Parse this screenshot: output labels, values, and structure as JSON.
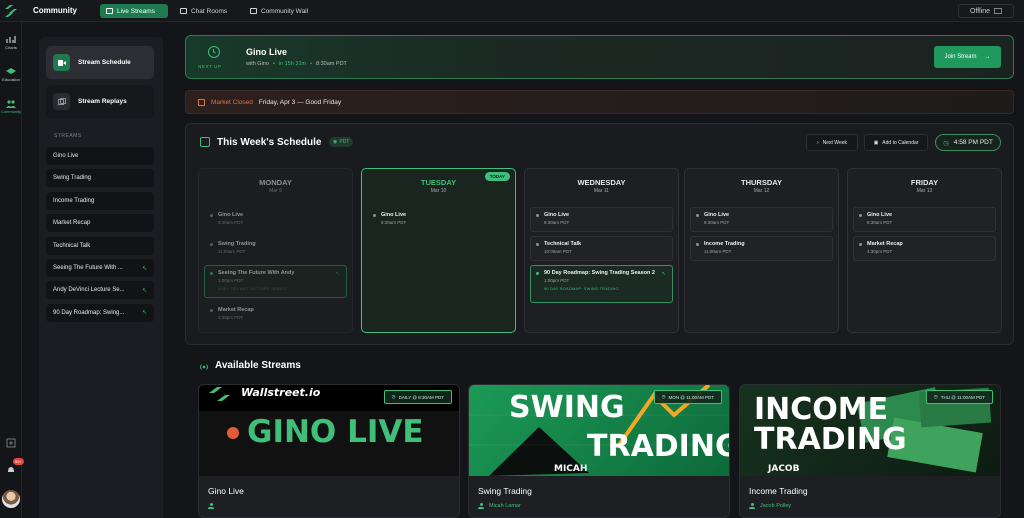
{
  "app": {
    "title": "Community"
  },
  "nav": {
    "tabs": [
      {
        "label": "Live Streams",
        "active": true
      },
      {
        "label": "Chat Rooms"
      },
      {
        "label": "Community Wall"
      }
    ],
    "status": "Offline"
  },
  "rail": {
    "items": [
      "Charts",
      "Education",
      "Community"
    ],
    "notification_count": "99+"
  },
  "sidebar": {
    "schedule_label": "Stream Schedule",
    "replays_label": "Stream Replays",
    "section_label": "STREAMS",
    "streams": [
      {
        "label": "Gino Live",
        "arrow": ""
      },
      {
        "label": "Swing Trading",
        "arrow": ""
      },
      {
        "label": "Income Trading",
        "arrow": ""
      },
      {
        "label": "Market Recap",
        "arrow": ""
      },
      {
        "label": "Technical Talk",
        "arrow": ""
      },
      {
        "label": "Seeing The Future With ...",
        "arrow": "↖"
      },
      {
        "label": "Andy DeVinci Lecture Se...",
        "arrow": "↖"
      },
      {
        "label": "90 Day Roadmap: Swing...",
        "arrow": "↖"
      }
    ]
  },
  "next_up": {
    "label": "NEXT UP",
    "title": "Gino Live",
    "host": "with Gino",
    "sep": "•",
    "countdown": "in 15h 31m",
    "time": "8:30am PDT",
    "join_label": "Join Stream",
    "join_arrow": "→"
  },
  "market": {
    "status": "Market Closed",
    "detail": "Friday, Apr 3 — Good Friday"
  },
  "schedule": {
    "title": "This Week's Schedule",
    "tz": "PDT",
    "next_week_label": "Next Week",
    "add_calendar_label": "Add to Calendar",
    "clock": "4:58 PM PDT",
    "today_badge": "TODAY",
    "days": [
      {
        "name": "MONDAY",
        "date": "Mar 9",
        "events": [
          {
            "title": "Gino Live",
            "time": "8:30am PDT"
          },
          {
            "title": "Swing Trading",
            "time": "11:00am PDT"
          },
          {
            "title": "Seeing The Future With Andy",
            "time": "1:00pm PDT",
            "sub": "ANDY DEVINCI LECTURE SERIES"
          },
          {
            "title": "Market Recap",
            "time": "4:30pm PDT"
          }
        ]
      },
      {
        "name": "TUESDAY",
        "date": "Mar 10",
        "events": [
          {
            "title": "Gino Live",
            "time": "8:30am PDT"
          }
        ]
      },
      {
        "name": "WEDNESDAY",
        "date": "Mar 11",
        "events": [
          {
            "title": "Gino Live",
            "time": "8:30am PDT"
          },
          {
            "title": "Technical Talk",
            "time": "10:00am PDT"
          },
          {
            "title": "90 Day Roadmap: Swing Trading Season 2",
            "time": "1:00pm PDT",
            "sub": "90 DAY ROADMAP: SWING TRADING"
          }
        ]
      },
      {
        "name": "THURSDAY",
        "date": "Mar 12",
        "events": [
          {
            "title": "Gino Live",
            "time": "8:30am PDT"
          },
          {
            "title": "Income Trading",
            "time": "11:00am PDT"
          }
        ]
      },
      {
        "name": "FRIDAY",
        "date": "Mar 13",
        "events": [
          {
            "title": "Gino Live",
            "time": "8:30am PDT"
          },
          {
            "title": "Market Recap",
            "time": "4:30pm PDT"
          }
        ]
      }
    ]
  },
  "available": {
    "title": "Available Streams",
    "cards": [
      {
        "title": "Gino Live",
        "host": "",
        "badge": "DAILY @ 8:30AM PDT",
        "thumb_brand": "Wallstreet.io",
        "thumb_text": "GINO LIVE"
      },
      {
        "title": "Swing Trading",
        "host": "Micah Lamar",
        "badge": "MON @ 11:00AM PDT",
        "thumb_line1": "SWING",
        "thumb_line2": "TRADING",
        "thumb_name": "MICAH"
      },
      {
        "title": "Income Trading",
        "host": "Jacob Polley",
        "badge": "THU @ 11:00AM PDT",
        "thumb_line1": "INCOME",
        "thumb_line2": "TRADING",
        "thumb_name": "JACOB"
      }
    ]
  },
  "colors": {
    "accent": "#3fbf7a",
    "accent_dark": "#1f7a4f",
    "market_closed": "#e0714a",
    "bg": "#141519"
  }
}
